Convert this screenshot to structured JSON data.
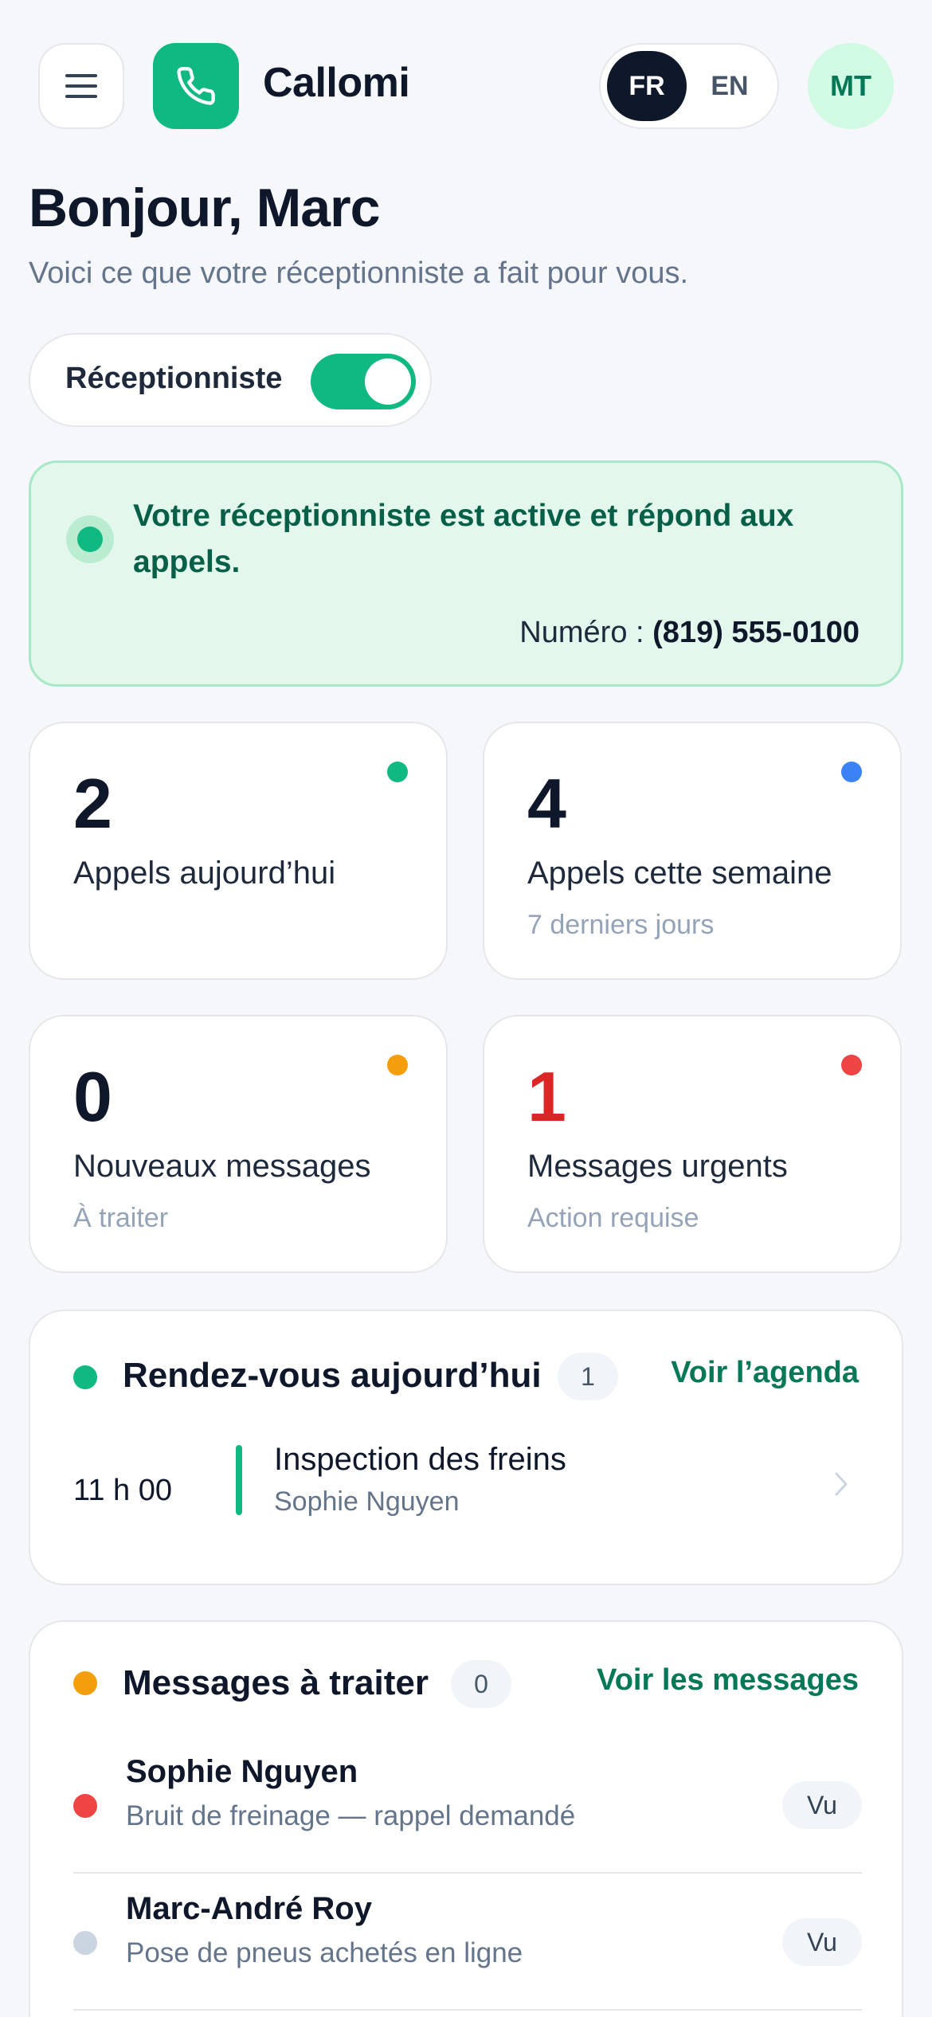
{
  "header": {
    "app_name": "Callomi",
    "lang": {
      "fr": "FR",
      "en": "EN",
      "active": "FR"
    },
    "avatar_initials": "MT",
    "icons": {
      "menu": "hamburger-icon",
      "logo": "phone-icon"
    }
  },
  "greeting": {
    "title": "Bonjour, Marc",
    "subtitle": "Voici ce que votre réceptionniste a fait pour vous."
  },
  "receptionist_toggle": {
    "label": "Réceptionniste",
    "on": true
  },
  "status": {
    "message": "Votre réceptionniste est active et répond aux appels.",
    "number_label": "Numéro :",
    "number": "(819) 555-0100"
  },
  "stats": [
    {
      "value": "2",
      "label": "Appels aujourd’hui",
      "sub": "",
      "dot_color": "#10b981",
      "value_color": "#0f172a"
    },
    {
      "value": "4",
      "label": "Appels cette semaine",
      "sub": "7 derniers jours",
      "dot_color": "#3b82f6",
      "value_color": "#0f172a"
    },
    {
      "value": "0",
      "label": "Nouveaux messages",
      "sub": "À traiter",
      "dot_color": "#f59e0b",
      "value_color": "#0f172a"
    },
    {
      "value": "1",
      "label": "Messages urgents",
      "sub": "Action requise",
      "dot_color": "#ef4444",
      "value_color": "#dc2626"
    }
  ],
  "appointments": {
    "title": "Rendez-vous aujourd’hui",
    "count": "1",
    "link": "Voir l’agenda",
    "dot_color": "#10b981",
    "items": [
      {
        "time": "11 h 00",
        "title": "Inspection des freins",
        "client": "Sophie Nguyen"
      }
    ]
  },
  "messages": {
    "title": "Messages à traiter",
    "count": "0",
    "link": "Voir les messages",
    "dot_color": "#f59e0b",
    "items": [
      {
        "name": "Sophie Nguyen",
        "summary": "Bruit de freinage — rappel demandé",
        "status": "Vu",
        "dot_color": "#ef4444"
      },
      {
        "name": "Marc-André Roy",
        "summary": "Pose de pneus achetés en ligne",
        "status": "Vu",
        "dot_color": "#cbd5e1"
      }
    ]
  },
  "colors": {
    "brand": "#10b981",
    "brand_dark": "#047857",
    "dark": "#0f172a"
  }
}
